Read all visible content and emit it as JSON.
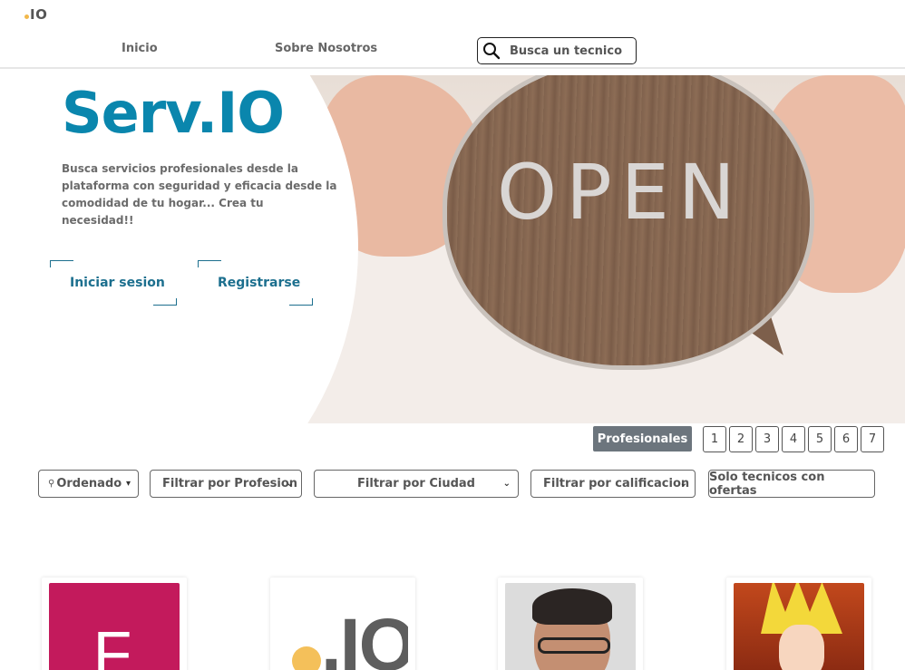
{
  "header": {
    "logo": ".IO",
    "nav": [
      {
        "label": "Inicio"
      },
      {
        "label": "Sobre Nosotros"
      }
    ],
    "search": {
      "placeholder": "Busca un tecnico",
      "value": ""
    }
  },
  "hero": {
    "title": "Serv.IO",
    "description": "Busca servicios profesionales desde la plataforma con seguridad y eficacia desde la comodidad de tu hogar... Crea tu necesidad!!",
    "sign_text": "OPEN",
    "buttons": {
      "login": "Iniciar sesion",
      "register": "Registrarse"
    }
  },
  "pagination": {
    "label": "Profesionales",
    "pages": [
      "1",
      "2",
      "3",
      "4",
      "5",
      "6",
      "7"
    ]
  },
  "filters": {
    "sort": "Ordenado",
    "profession": "Filtrar por Profesion",
    "city": "Filtrar por Ciudad",
    "rating": "Filtrar por calificacion",
    "offers": "Solo tecnicos con ofertas"
  },
  "cards": [
    {
      "mark": "",
      "image_text": "F",
      "image_color": "#c31a5c"
    },
    {
      "mark": "",
      "image_text": ".IO"
    },
    {
      "mark": ""
    },
    {
      "mark": ""
    }
  ],
  "colors": {
    "brand": "#0a86ad",
    "accent_dot": "#f2b84b",
    "pagination_bg": "#6c757d"
  }
}
